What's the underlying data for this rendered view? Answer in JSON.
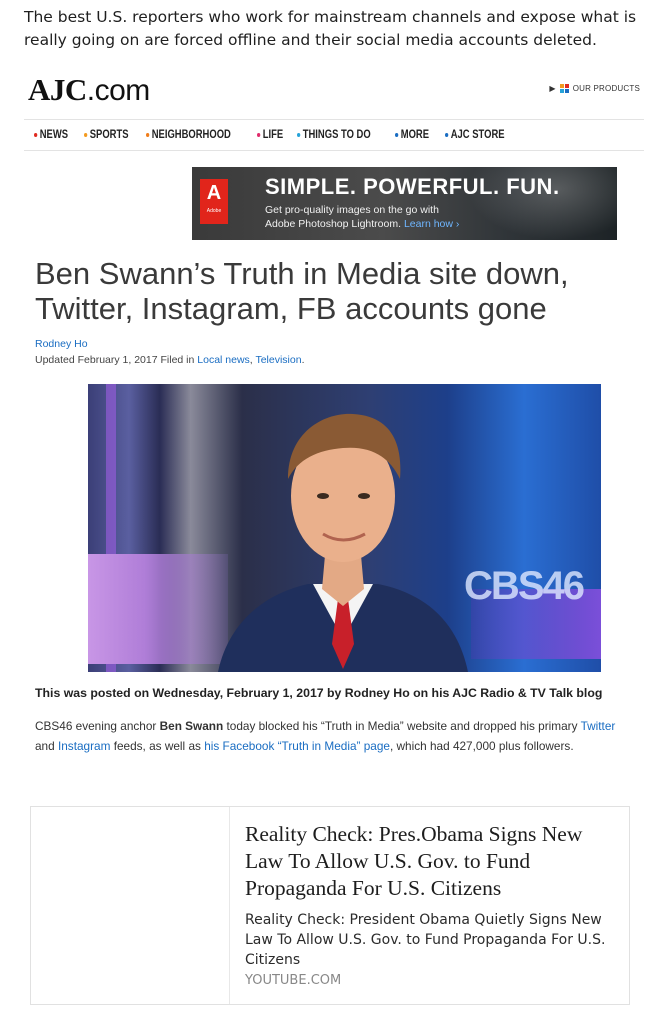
{
  "intro_text": "The best U.S. reporters who work for mainstream channels and expose what is really going on are forced offline and their social media accounts deleted.",
  "site": {
    "logo_main": "AJC",
    "logo_suffix": ".com",
    "products_label": "OUR PRODUCTS"
  },
  "nav": {
    "items": [
      {
        "label": "NEWS",
        "color": "#e02b20"
      },
      {
        "label": "SPORTS",
        "color": "#f39a1f"
      },
      {
        "label": "NEIGHBORHOOD",
        "color": "#f07d1a"
      },
      {
        "label": "LIFE",
        "color": "#e02b6c"
      },
      {
        "label": "THINGS TO DO",
        "color": "#26a3d9"
      },
      {
        "label": "MORE",
        "color": "#1a6dc2"
      },
      {
        "label": "AJC STORE",
        "color": "#1a6dc2"
      }
    ]
  },
  "ad": {
    "brand_mark": "A",
    "brand_text": "Adobe",
    "headline": "SIMPLE. POWERFUL. FUN.",
    "line1": "Get pro-quality images on the go with",
    "line2": "Adobe Photoshop Lightroom.",
    "cta": "Learn how ›"
  },
  "article": {
    "headline": "Ben Swann’s Truth in Media site down, Twitter, Instagram, FB accounts gone",
    "author": "Rodney Ho",
    "updated_prefix": "Updated February 1, 2017 Filed in ",
    "category1": "Local news",
    "category_sep": ", ",
    "category2": "Television",
    "category_end": ".",
    "photo_overlay": "CBS46",
    "post_note": "This was posted on Wednesday, February 1, 2017 by Rodney Ho on his AJC Radio & TV Talk blog",
    "body": {
      "p1": "CBS46 evening anchor ",
      "p_name": "Ben Swann",
      "p2": " today blocked his “Truth in Media” website and dropped his primary ",
      "link_twitter": "Twitter",
      "p3": " and ",
      "link_instagram": "Instagram",
      "p4": " feeds, as well as ",
      "link_fb": "his Facebook “Truth in Media” page",
      "p5": ", which had 427,000 plus followers."
    }
  },
  "link_card": {
    "title": "Reality Check: Pres.Obama Signs New Law To Allow U.S. Gov. to Fund Propaganda For U.S. Citizens",
    "description": "Reality Check: President Obama Quietly Signs New Law To Allow U.S. Gov. to Fund Propaganda For U.S. Citizens",
    "source": "YOUTUBE.COM"
  }
}
